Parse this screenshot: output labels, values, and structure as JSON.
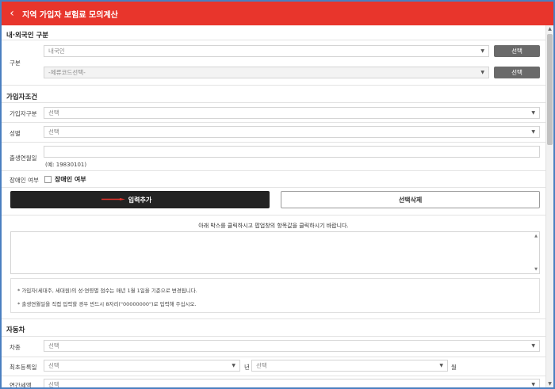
{
  "header": {
    "back_icon": "chevron-left-icon",
    "title": "지역 가입자 보험료 모의계산"
  },
  "section_nationality": {
    "title": "내·외국인 구분",
    "label": "구분",
    "select_nationality": "내국인",
    "select_stay_code": "-체류코드선택-",
    "button_select": "선택"
  },
  "section_member": {
    "title": "가입자조건",
    "member_type_label": "가입자구분",
    "member_type_value": "선택",
    "gender_label": "성별",
    "gender_value": "선택",
    "birth_label": "출생연월일",
    "birth_value": "",
    "birth_hint": "(예: 19830101)",
    "disability_label": "장애인 여부",
    "disability_check_label": "장애인 여부"
  },
  "actions": {
    "add_label": "입력추가",
    "delete_label": "선택삭제"
  },
  "notice": {
    "instruction": "아래 박스를 클릭하시고 팝업창의 항목값을 클릭하시기 바랍니다."
  },
  "notes": [
    "* 가입자(세대주, 세대원)의 성·연령별 점수는 매년 1월 1일을 기준으로 변경됩니다.",
    "* 출생연월일을 직접 입력할 경우 반드시 8자리(\"00000000\")로 입력해 주십시오."
  ],
  "section_car": {
    "title": "자동차",
    "car_type_label": "차종",
    "car_type_value": "선택",
    "first_reg_label": "최초등록일",
    "year_value": "선택",
    "year_unit": "년",
    "month_value": "선택",
    "month_unit": "월",
    "tax_label": "연간세액",
    "tax_value": "선택"
  },
  "colors": {
    "header_bg": "#e8352c",
    "dark_button": "#232323",
    "small_button": "#6a6a6a",
    "frame_border": "#4a7fc0"
  }
}
